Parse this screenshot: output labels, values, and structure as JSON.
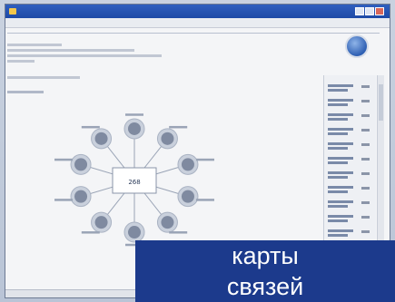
{
  "desktop": {
    "accent": "#1e4aa6",
    "overlay_color": "#1c3a8c"
  },
  "window": {
    "title": ""
  },
  "overlay": {
    "line1": "карты",
    "line2": "связей"
  },
  "diagram": {
    "center": {
      "value": "268"
    },
    "nodes": [
      {
        "value": ""
      },
      {
        "value": ""
      },
      {
        "value": ""
      },
      {
        "value": ""
      },
      {
        "value": ""
      },
      {
        "value": ""
      },
      {
        "value": ""
      },
      {
        "value": ""
      },
      {
        "value": ""
      },
      {
        "value": ""
      }
    ]
  }
}
